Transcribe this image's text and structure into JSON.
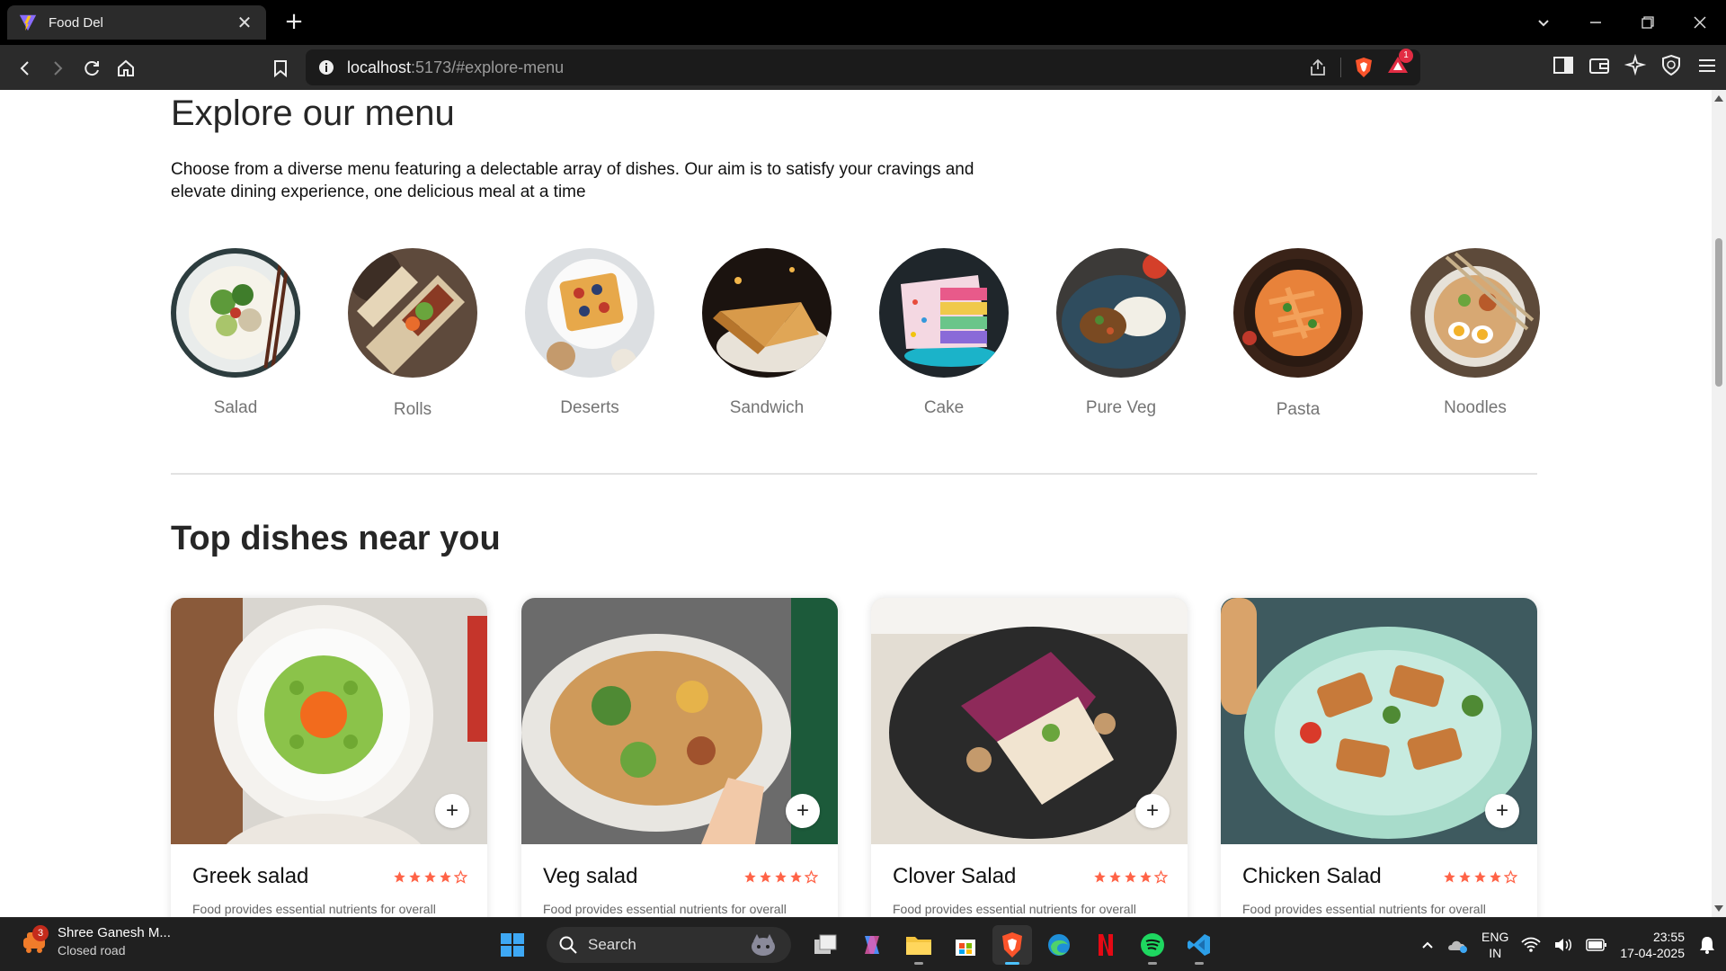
{
  "browser": {
    "tab_title": "Food Del",
    "url_host": "localhost",
    "url_rest": ":5173/#explore-menu",
    "notification_count": "1",
    "accent": "#fb542b"
  },
  "explore": {
    "title": "Explore our menu",
    "text": "Choose from a diverse menu featuring a delectable array of dishes. Our aim is to satisfy your cravings and elevate dining experience, one delicious meal at a time",
    "items": [
      {
        "label": "Salad"
      },
      {
        "label": "Rolls"
      },
      {
        "label": "Deserts"
      },
      {
        "label": "Sandwich"
      },
      {
        "label": "Cake"
      },
      {
        "label": "Pure Veg"
      },
      {
        "label": "Pasta"
      },
      {
        "label": "Noodles"
      }
    ]
  },
  "top_dishes": {
    "title": "Top dishes near you",
    "rating_color": "#ff6347",
    "cards": [
      {
        "name": "Greek salad",
        "rating": 4,
        "add_label": "+",
        "desc": "Food provides essential nutrients for overall"
      },
      {
        "name": "Veg salad",
        "rating": 4,
        "add_label": "+",
        "desc": "Food provides essential nutrients for overall"
      },
      {
        "name": "Clover Salad",
        "rating": 4,
        "add_label": "+",
        "desc": "Food provides essential nutrients for overall"
      },
      {
        "name": "Chicken Salad",
        "rating": 4,
        "add_label": "+",
        "desc": "Food provides essential nutrients for overall"
      }
    ]
  },
  "taskbar": {
    "weather_title": "Shree Ganesh M...",
    "weather_sub": "Closed road",
    "weather_badge": "3",
    "search_label": "Search",
    "lang_top": "ENG",
    "lang_bottom": "IN",
    "time": "23:55",
    "date": "17-04-2025"
  }
}
